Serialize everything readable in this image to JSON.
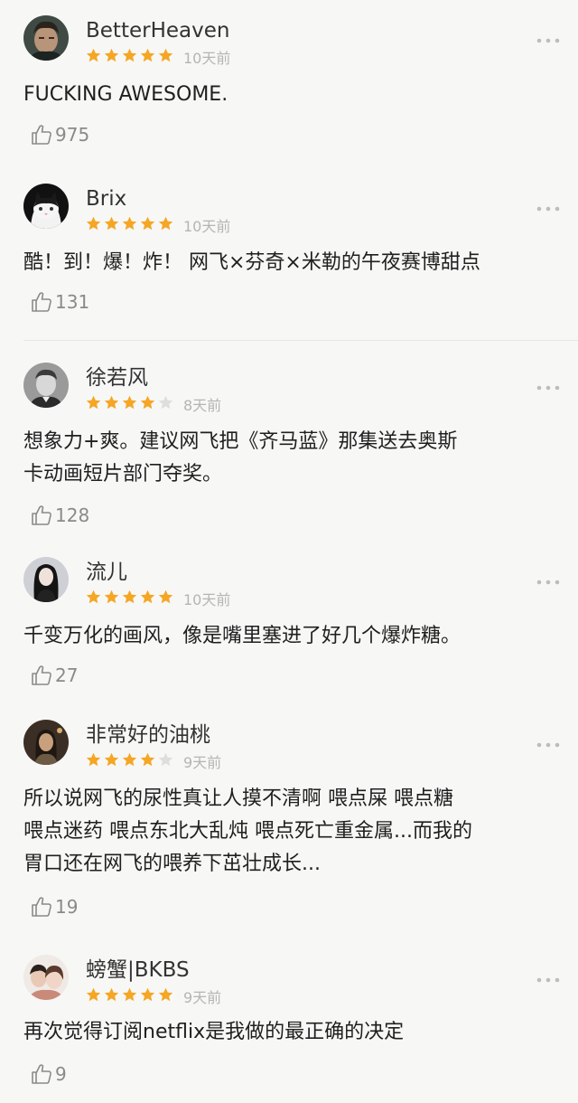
{
  "colors": {
    "star_filled": "#f5a623",
    "star_empty": "#dedede",
    "time_text": "#b5b5b5",
    "like_text": "#8a8a8a",
    "background": "#f7f7f5"
  },
  "icons": {
    "more": "more-dots-icon",
    "like": "thumbs-up-icon",
    "star": "star-icon"
  },
  "reviews": [
    {
      "username": "BetterHeaven",
      "rating": 5,
      "time": "10天前",
      "content": "FUCKING AWESOME.",
      "likes": "975"
    },
    {
      "username": "Brix",
      "rating": 5,
      "time": "10天前",
      "content": "酷！到！爆！炸！ 网飞×芬奇×米勒的午夜赛博甜点",
      "likes": "131"
    },
    {
      "username": "徐若风",
      "rating": 4,
      "time": "8天前",
      "content": "想象力+爽。建议网飞把《齐马蓝》那集送去奥斯\n卡动画短片部门夺奖。",
      "likes": "128"
    },
    {
      "username": "流儿",
      "rating": 5,
      "time": "10天前",
      "content": "千变万化的画风，像是嘴里塞进了好几个爆炸糖。",
      "likes": "27"
    },
    {
      "username": "非常好的油桃",
      "rating": 4,
      "time": "9天前",
      "content": "所以说网飞的尿性真让人摸不清啊 喂点屎 喂点糖\n喂点迷药 喂点东北大乱炖 喂点死亡重金属...而我的\n胃口还在网飞的喂养下茁壮成长...",
      "likes": "19"
    },
    {
      "username": "螃蟹|BKBS",
      "rating": 5,
      "time": "9天前",
      "content": "再次觉得订阅netflix是我做的最正确的决定",
      "likes": "9"
    }
  ]
}
